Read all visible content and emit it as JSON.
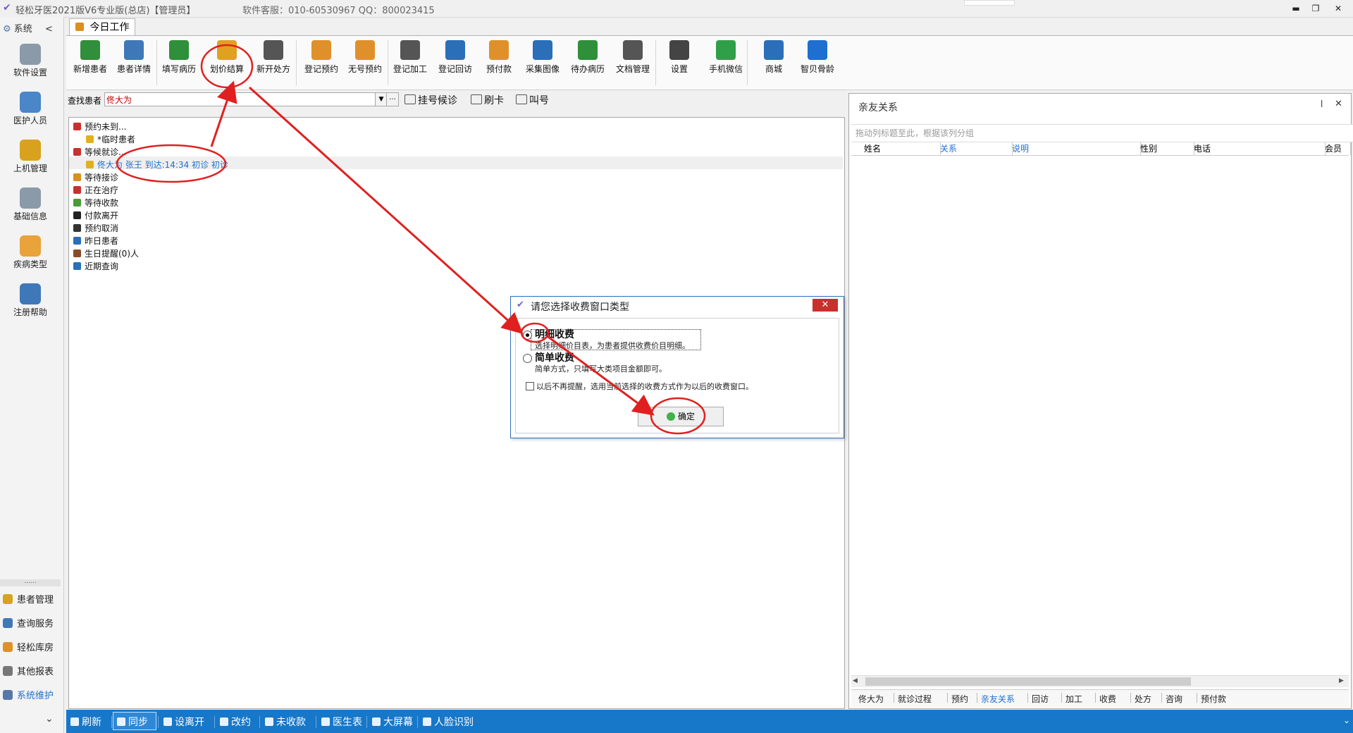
{
  "window": {
    "title": "轻松牙医2021版V6专业版(总店)【管理员】",
    "service": "软件客服：010-60530967 QQ：800023415",
    "controls": {
      "minimize": "▬",
      "restore": "❐",
      "close": "✕"
    }
  },
  "sidebar": {
    "header": "系统",
    "collapse": "<",
    "items": [
      {
        "label": "软件设置",
        "icon": "gear-icon",
        "color": "#8a9aa8"
      },
      {
        "label": "医护人员",
        "icon": "users-icon",
        "color": "#4a86c8"
      },
      {
        "label": "上机管理",
        "icon": "lock-icon",
        "color": "#d8a21e"
      },
      {
        "label": "基础信息",
        "icon": "settings-icon",
        "color": "#8a9aa8"
      },
      {
        "label": "疾病类型",
        "icon": "tree-icon",
        "color": "#e8a33a"
      },
      {
        "label": "注册帮助",
        "icon": "help-icon",
        "color": "#3f78b8"
      }
    ],
    "more": "......",
    "bottom_items": [
      {
        "label": "患者管理",
        "icon": "patients-icon",
        "color": "#d8a21e"
      },
      {
        "label": "查询服务",
        "icon": "query-icon",
        "color": "#3f78b8"
      },
      {
        "label": "轻松库房",
        "icon": "storage-icon",
        "color": "#e0902a"
      },
      {
        "label": "其他报表",
        "icon": "report-icon",
        "color": "#777777"
      },
      {
        "label": "系统维护",
        "icon": "system-icon",
        "color": "#5577aa"
      }
    ],
    "expand": "⌄"
  },
  "tab": {
    "label": "今日工作"
  },
  "ribbon": {
    "buttons": [
      {
        "label": "新增患者",
        "icon": "add-patient-icon",
        "color": "#2f8f3a"
      },
      {
        "label": "患者详情",
        "icon": "patient-detail-icon",
        "color": "#3f78b8"
      },
      {
        "label": "填写病历",
        "icon": "write-record-icon",
        "color": "#2f8f3a"
      },
      {
        "label": "划价结算",
        "icon": "billing-icon",
        "color": "#e0a020"
      },
      {
        "label": "新开处方",
        "icon": "prescription-icon",
        "color": "#555555"
      },
      {
        "label": "登记预约",
        "icon": "register-appointment-icon",
        "color": "#e0902a"
      },
      {
        "label": "无号预约",
        "icon": "calendar-icon",
        "color": "#e0902a"
      },
      {
        "label": "登记加工",
        "icon": "process-icon",
        "color": "#555555"
      },
      {
        "label": "登记回访",
        "icon": "phone-icon",
        "color": "#2a6fb8"
      },
      {
        "label": "预付款",
        "icon": "prepay-icon",
        "color": "#e0902a"
      },
      {
        "label": "采集图像",
        "icon": "image-icon",
        "color": "#2a6fb8"
      },
      {
        "label": "待办病历",
        "icon": "todo-record-icon",
        "color": "#2f8f3a"
      },
      {
        "label": "文档管理",
        "icon": "document-icon",
        "color": "#555555"
      },
      {
        "label": "设置",
        "icon": "settings-ring-icon",
        "color": "#444444"
      },
      {
        "label": "手机微信",
        "icon": "wechat-icon",
        "color": "#2f9f4a"
      },
      {
        "label": "商城",
        "icon": "mall-icon",
        "color": "#2a6fb8"
      },
      {
        "label": "智贝骨龄",
        "icon": "bone-age-icon",
        "color": "#1e6fd0"
      }
    ]
  },
  "search": {
    "label": "查找患者",
    "value": "佟大为",
    "buttons": [
      "挂号候诊",
      "刷卡",
      "叫号"
    ]
  },
  "tree": {
    "rows": [
      {
        "label": "预约未到...",
        "icon": "calendar-small-icon",
        "color": "#c83030",
        "indent": 0
      },
      {
        "label": "*临时患者",
        "icon": "face-icon",
        "color": "#e0b020",
        "indent": 1
      },
      {
        "label": "等候就诊...",
        "icon": "wait-icon",
        "color": "#c83030",
        "indent": 0
      },
      {
        "label": "佟大为  张王  到达:14:34  初诊  初诊",
        "icon": "face-icon",
        "color": "#e0b020",
        "indent": 1,
        "selected": true
      },
      {
        "label": "等待接诊",
        "icon": "receive-icon",
        "color": "#d89020",
        "indent": 0
      },
      {
        "label": "正在治疗",
        "icon": "treat-icon",
        "color": "#c83030",
        "indent": 0
      },
      {
        "label": "等待收款",
        "icon": "money-icon",
        "color": "#4a9a3a",
        "indent": 0
      },
      {
        "label": "付款离开",
        "icon": "walk-icon",
        "color": "#222222",
        "indent": 0
      },
      {
        "label": "预约取消",
        "icon": "cancel-icon",
        "color": "#333333",
        "indent": 0
      },
      {
        "label": "昨日患者",
        "icon": "eye-icon",
        "color": "#2a6fb8",
        "indent": 0
      },
      {
        "label": "生日提醒(0)人",
        "icon": "cake-icon",
        "color": "#8a4a2a",
        "indent": 0
      },
      {
        "label": "近期查询",
        "icon": "search-small-icon",
        "color": "#2a6fb8",
        "indent": 0
      }
    ]
  },
  "right_panel": {
    "title": "亲友关系",
    "pin": "ꟾ",
    "close": "✕",
    "group_hint": "拖动列标题至此，根据该列分组",
    "columns": [
      {
        "label": "姓名",
        "blue": false
      },
      {
        "label": "关系",
        "blue": true
      },
      {
        "label": "说明",
        "blue": true
      },
      {
        "label": "性别",
        "blue": false
      },
      {
        "label": "电话",
        "blue": false
      },
      {
        "label": "会员",
        "blue": false
      }
    ],
    "tabs": [
      "佟大为",
      "就诊过程",
      "预约",
      "亲友关系",
      "回访",
      "加工",
      "收费",
      "处方",
      "咨询",
      "预付款"
    ],
    "active_tab": "亲友关系"
  },
  "status_bar": {
    "buttons": [
      "刷新",
      "同步",
      "设离开",
      "改约",
      "未收款",
      "医生表",
      "大屏幕",
      "人脸识别"
    ]
  },
  "dialog": {
    "title": "请您选择收费窗口类型",
    "close": "✕",
    "option1_title": "明细收费",
    "option1_desc": "选择明细价目表，为患者提供收费价目明细。",
    "option2_title": "简单收费",
    "option2_desc": "简单方式，只填写大类项目金额即可。",
    "remember": "以后不再提醒，选用当前选择的收费方式作为以后的收费窗口。",
    "ok": "确定",
    "selected_option": 1,
    "remember_checked": false
  },
  "colors": {
    "status_bar": "#1777c9",
    "annotation": "#e02020",
    "dialog_border": "#2f6fbf",
    "close_red": "#c9302c"
  }
}
